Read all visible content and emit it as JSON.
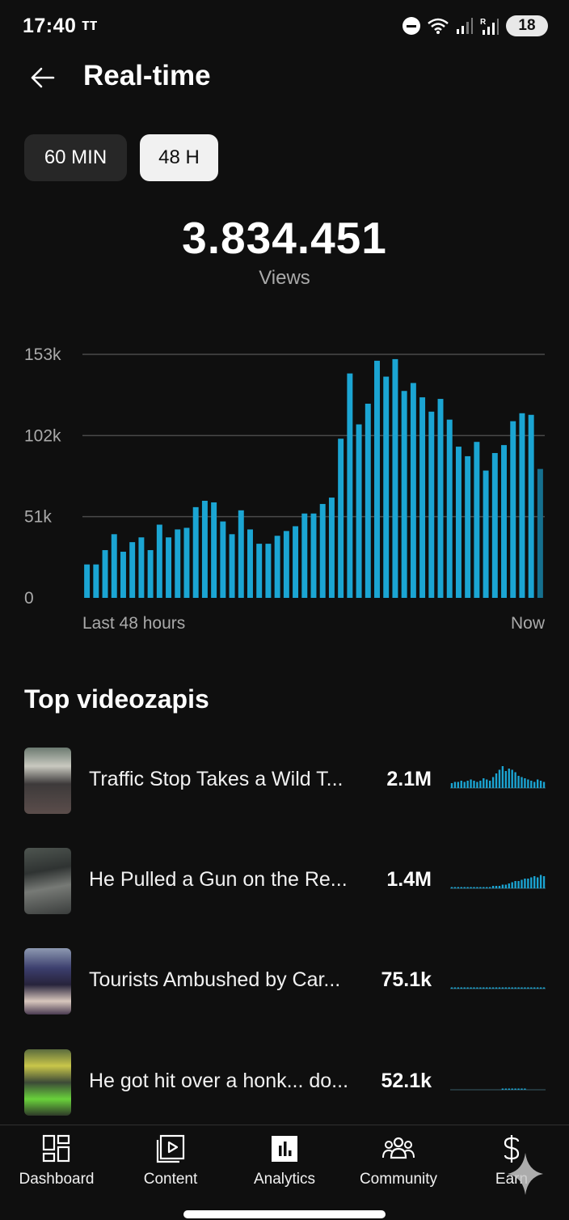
{
  "status_bar": {
    "time": "17:40",
    "carrier_glyph": "ᴛᴛ",
    "battery": "18",
    "signal_label": "R"
  },
  "header": {
    "title": "Real-time",
    "back_icon": "arrow-left-icon"
  },
  "range_tabs": [
    {
      "label": "60 MIN",
      "selected": false
    },
    {
      "label": "48 H",
      "selected": true
    }
  ],
  "summary": {
    "total": "3.834.451",
    "label": "Views"
  },
  "chart_data": {
    "type": "bar",
    "title": "",
    "x_start_label": "Last 48 hours",
    "x_end_label": "Now",
    "y_ticks": [
      "0",
      "51k",
      "102k",
      "153k"
    ],
    "ylim": [
      0,
      153000
    ],
    "values": [
      21000,
      21000,
      30000,
      40000,
      29000,
      35000,
      38000,
      30000,
      46000,
      38000,
      43000,
      44000,
      57000,
      61000,
      60000,
      48000,
      40000,
      55000,
      43000,
      34000,
      34000,
      39000,
      42000,
      45000,
      53000,
      53000,
      59000,
      63000,
      100000,
      141000,
      109000,
      122000,
      149000,
      139000,
      150000,
      130000,
      135000,
      126000,
      117000,
      125000,
      112000,
      95000,
      89000,
      98000,
      80000,
      91000,
      96000,
      111000,
      116000,
      115000,
      81000
    ],
    "bar_color": "#1ba5d3",
    "grid": true
  },
  "top_videos": {
    "title": "Top videozapis",
    "items": [
      {
        "title": "Traffic Stop Takes a Wild T...",
        "views": "2.1M",
        "spark": [
          4,
          5,
          5,
          6,
          5,
          6,
          7,
          6,
          5,
          6,
          8,
          7,
          6,
          9,
          12,
          15,
          18,
          14,
          16,
          15,
          13,
          10,
          9,
          8,
          7,
          6,
          5,
          7,
          6,
          5
        ],
        "spark_scale": 20
      },
      {
        "title": "He Pulled a Gun on the Re...",
        "views": "1.4M",
        "spark": [
          1,
          1,
          1,
          1,
          1,
          1,
          1,
          1,
          1,
          1,
          1,
          1,
          1,
          2,
          2,
          2,
          3,
          3,
          4,
          5,
          6,
          6,
          7,
          8,
          8,
          9,
          10,
          9,
          11,
          10
        ],
        "spark_scale": 20
      },
      {
        "title": "Tourists Ambushed by Car...",
        "views": "75.1k",
        "spark": [
          1,
          1,
          1,
          1,
          1,
          1,
          1,
          1,
          1,
          1,
          1,
          1,
          1,
          1,
          1,
          1,
          1,
          1,
          1,
          1,
          1,
          1,
          1,
          1,
          1,
          1,
          1,
          1,
          1,
          1
        ],
        "spark_scale": 20
      },
      {
        "title": "He got hit over a honk... do...",
        "views": "52.1k",
        "spark": [
          0,
          0,
          0,
          0,
          0,
          0,
          0,
          0,
          0,
          0,
          0,
          0,
          0,
          0,
          0,
          0,
          1,
          1,
          1,
          1,
          1,
          1,
          1,
          1,
          0,
          0,
          0,
          0,
          0,
          0
        ],
        "spark_scale": 20
      }
    ]
  },
  "bottom_nav": [
    {
      "label": "Dashboard",
      "icon": "dashboard-icon",
      "active": false
    },
    {
      "label": "Content",
      "icon": "content-icon",
      "active": false
    },
    {
      "label": "Analytics",
      "icon": "analytics-icon",
      "active": true
    },
    {
      "label": "Community",
      "icon": "community-icon",
      "active": false
    },
    {
      "label": "Earn",
      "icon": "earn-icon",
      "active": false
    }
  ]
}
